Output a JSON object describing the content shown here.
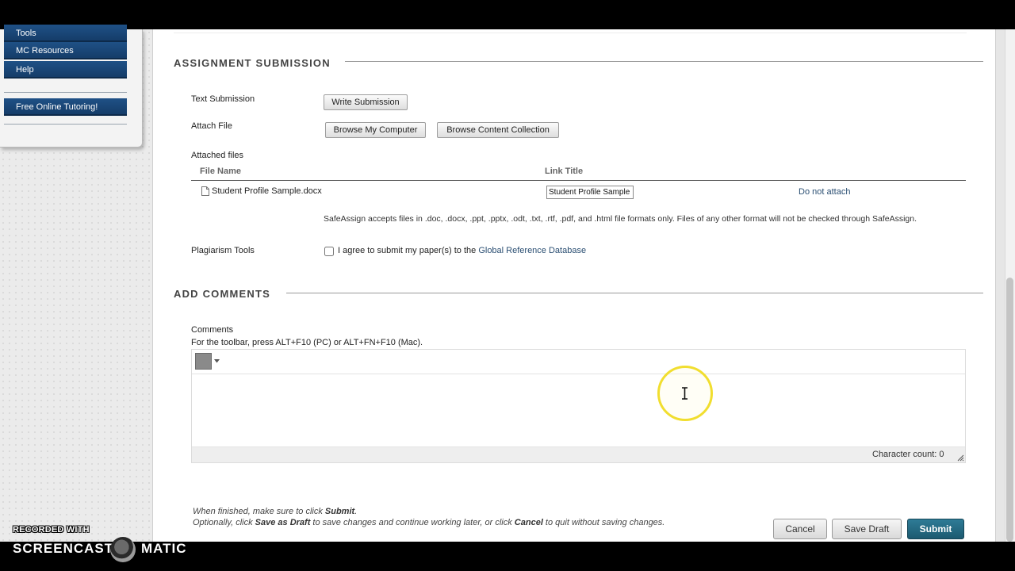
{
  "sidebar": {
    "items": [
      {
        "label": "Tools"
      },
      {
        "label": "MC Resources"
      },
      {
        "label": "Help"
      }
    ],
    "tutoring_label": "Free Online Tutoring!"
  },
  "assignment_submission": {
    "title": "ASSIGNMENT SUBMISSION",
    "text_submission_label": "Text Submission",
    "write_submission_button": "Write Submission",
    "attach_file_label": "Attach File",
    "browse_computer_button": "Browse My Computer",
    "browse_collection_button": "Browse Content Collection",
    "attached_files_label": "Attached files",
    "columns": {
      "file_name": "File Name",
      "link_title": "Link Title"
    },
    "files": [
      {
        "name": "Student Profile Sample.docx",
        "link_title": "Student Profile Sample",
        "action": "Do not attach"
      }
    ],
    "safeassign_note": "SafeAssign accepts files in .doc, .docx, .ppt, .pptx, .odt, .txt, .rtf, .pdf, and .html file formats only. Files of any other format will not be checked through SafeAssign.",
    "plagiarism_label": "Plagiarism Tools",
    "agree_text": "I agree to submit my paper(s) to the",
    "agree_link": "Global Reference Database",
    "agree_checked": false
  },
  "add_comments": {
    "title": "ADD COMMENTS",
    "comments_label": "Comments",
    "toolbar_hint": "For the toolbar, press ALT+F10 (PC) or ALT+FN+F10 (Mac).",
    "character_count": "Character count: 0"
  },
  "footer": {
    "finish_prefix": "When finished, make sure to click ",
    "finish_strong": "Submit",
    "finish_suffix": ".",
    "opt_1": "Optionally, click ",
    "opt_save": "Save as Draft",
    "opt_2": " to save changes and continue working later, or click ",
    "opt_cancel": "Cancel",
    "opt_3": " to quit without saving changes.",
    "cancel_button": "Cancel",
    "save_draft_button": "Save Draft",
    "submit_button": "Submit"
  },
  "watermark": {
    "recorded_with": "RECORDED WITH",
    "brand_left": "SCREENCAST",
    "brand_right": "MATIC"
  },
  "colors": {
    "nav_blue": "#1a4a7c",
    "submit_teal": "#236a82",
    "link": "#2a4e72",
    "cursor_highlight": "#f1de2f"
  }
}
